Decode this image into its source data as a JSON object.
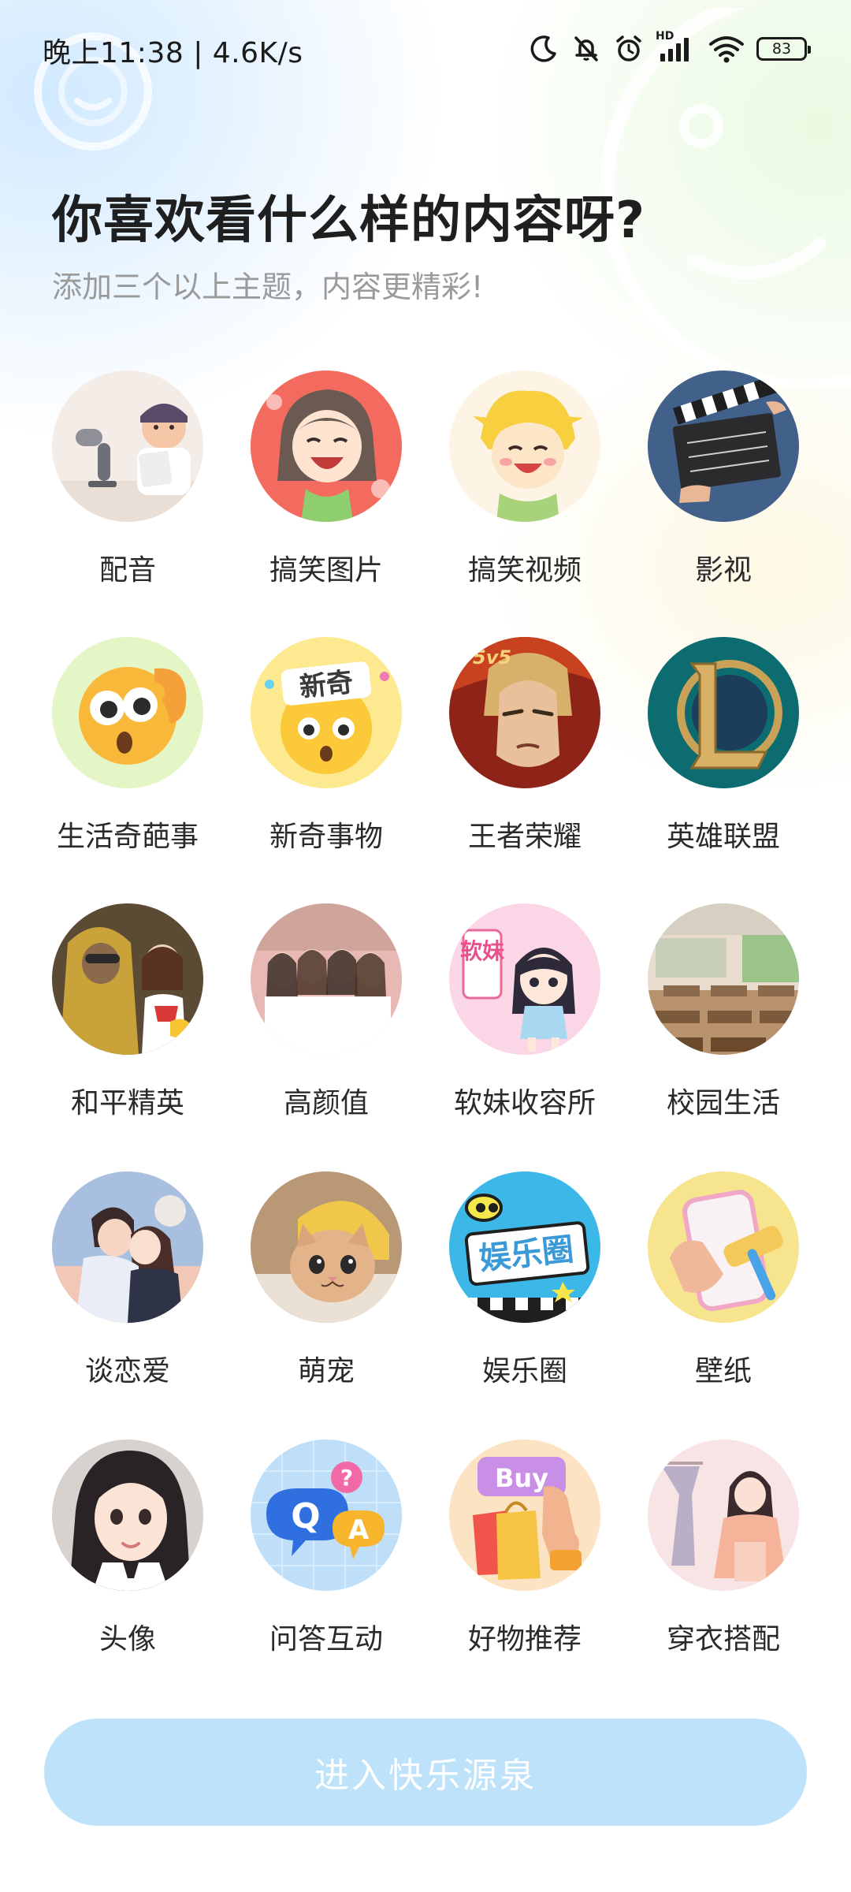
{
  "status_bar": {
    "time": "晚上11:38 | 4.6K/s",
    "network_label": "HD",
    "battery": "83"
  },
  "header": {
    "title": "你喜欢看什么样的内容呀?",
    "subtitle": "添加三个以上主题，内容更精彩!"
  },
  "topics": [
    {
      "label": "配音",
      "icon": "dubbing-icon",
      "color": "#f3ebe4"
    },
    {
      "label": "搞笑图片",
      "icon": "funny-pictures-icon",
      "color": "#f36b5e"
    },
    {
      "label": "搞笑视频",
      "icon": "funny-videos-icon",
      "color": "#fcf1e0"
    },
    {
      "label": "影视",
      "icon": "clapperboard-icon",
      "color": "#3b5a82"
    },
    {
      "label": "生活奇葩事",
      "icon": "surprised-ear-emoji-icon",
      "color": "#e3f5c4"
    },
    {
      "label": "新奇事物",
      "icon": "novelty-emoji-icon",
      "color": "#fce58a"
    },
    {
      "label": "王者荣耀",
      "icon": "honor-of-kings-icon",
      "color": "#a22a1f"
    },
    {
      "label": "英雄联盟",
      "icon": "league-of-legends-icon",
      "color": "#0f6b6f"
    },
    {
      "label": "和平精英",
      "icon": "peace-elite-icon",
      "color": "#6e5a3a"
    },
    {
      "label": "高颜值",
      "icon": "good-looks-icon",
      "color": "#d9a6ad"
    },
    {
      "label": "软妹收容所",
      "icon": "cute-girl-icon",
      "color": "#f8d3e4"
    },
    {
      "label": "校园生活",
      "icon": "classroom-icon",
      "color": "#c9b49a"
    },
    {
      "label": "谈恋爱",
      "icon": "couple-icon",
      "color": "#9cb3d6"
    },
    {
      "label": "萌宠",
      "icon": "kitten-icon",
      "color": "#c9a57a"
    },
    {
      "label": "娱乐圈",
      "icon": "entertainment-icon",
      "color": "#38b7e8"
    },
    {
      "label": "壁纸",
      "icon": "phone-paint-icon",
      "color": "#f6e28a"
    },
    {
      "label": "头像",
      "icon": "avatar-portrait-icon",
      "color": "#d8d0cc"
    },
    {
      "label": "问答互动",
      "icon": "qa-bubble-icon",
      "color": "#b9dcf7"
    },
    {
      "label": "好物推荐",
      "icon": "shopping-bags-icon",
      "color": "#fbe2c0"
    },
    {
      "label": "穿衣搭配",
      "icon": "outfit-icon",
      "color": "#f6dfe0"
    }
  ],
  "topic_badges": {
    "novelty": "新奇",
    "cute_girl": "软妹",
    "entertainment": "娱乐圈",
    "buy": "Buy",
    "qa_q": "Q",
    "qa_a": "A",
    "qa_mark": "?",
    "kings": "5v5"
  },
  "enter_button": {
    "label": "进入快乐源泉"
  },
  "colors": {
    "button_bg": "#bfe2fb",
    "title": "#1f1f1f",
    "subtitle": "#9a9a9a"
  }
}
